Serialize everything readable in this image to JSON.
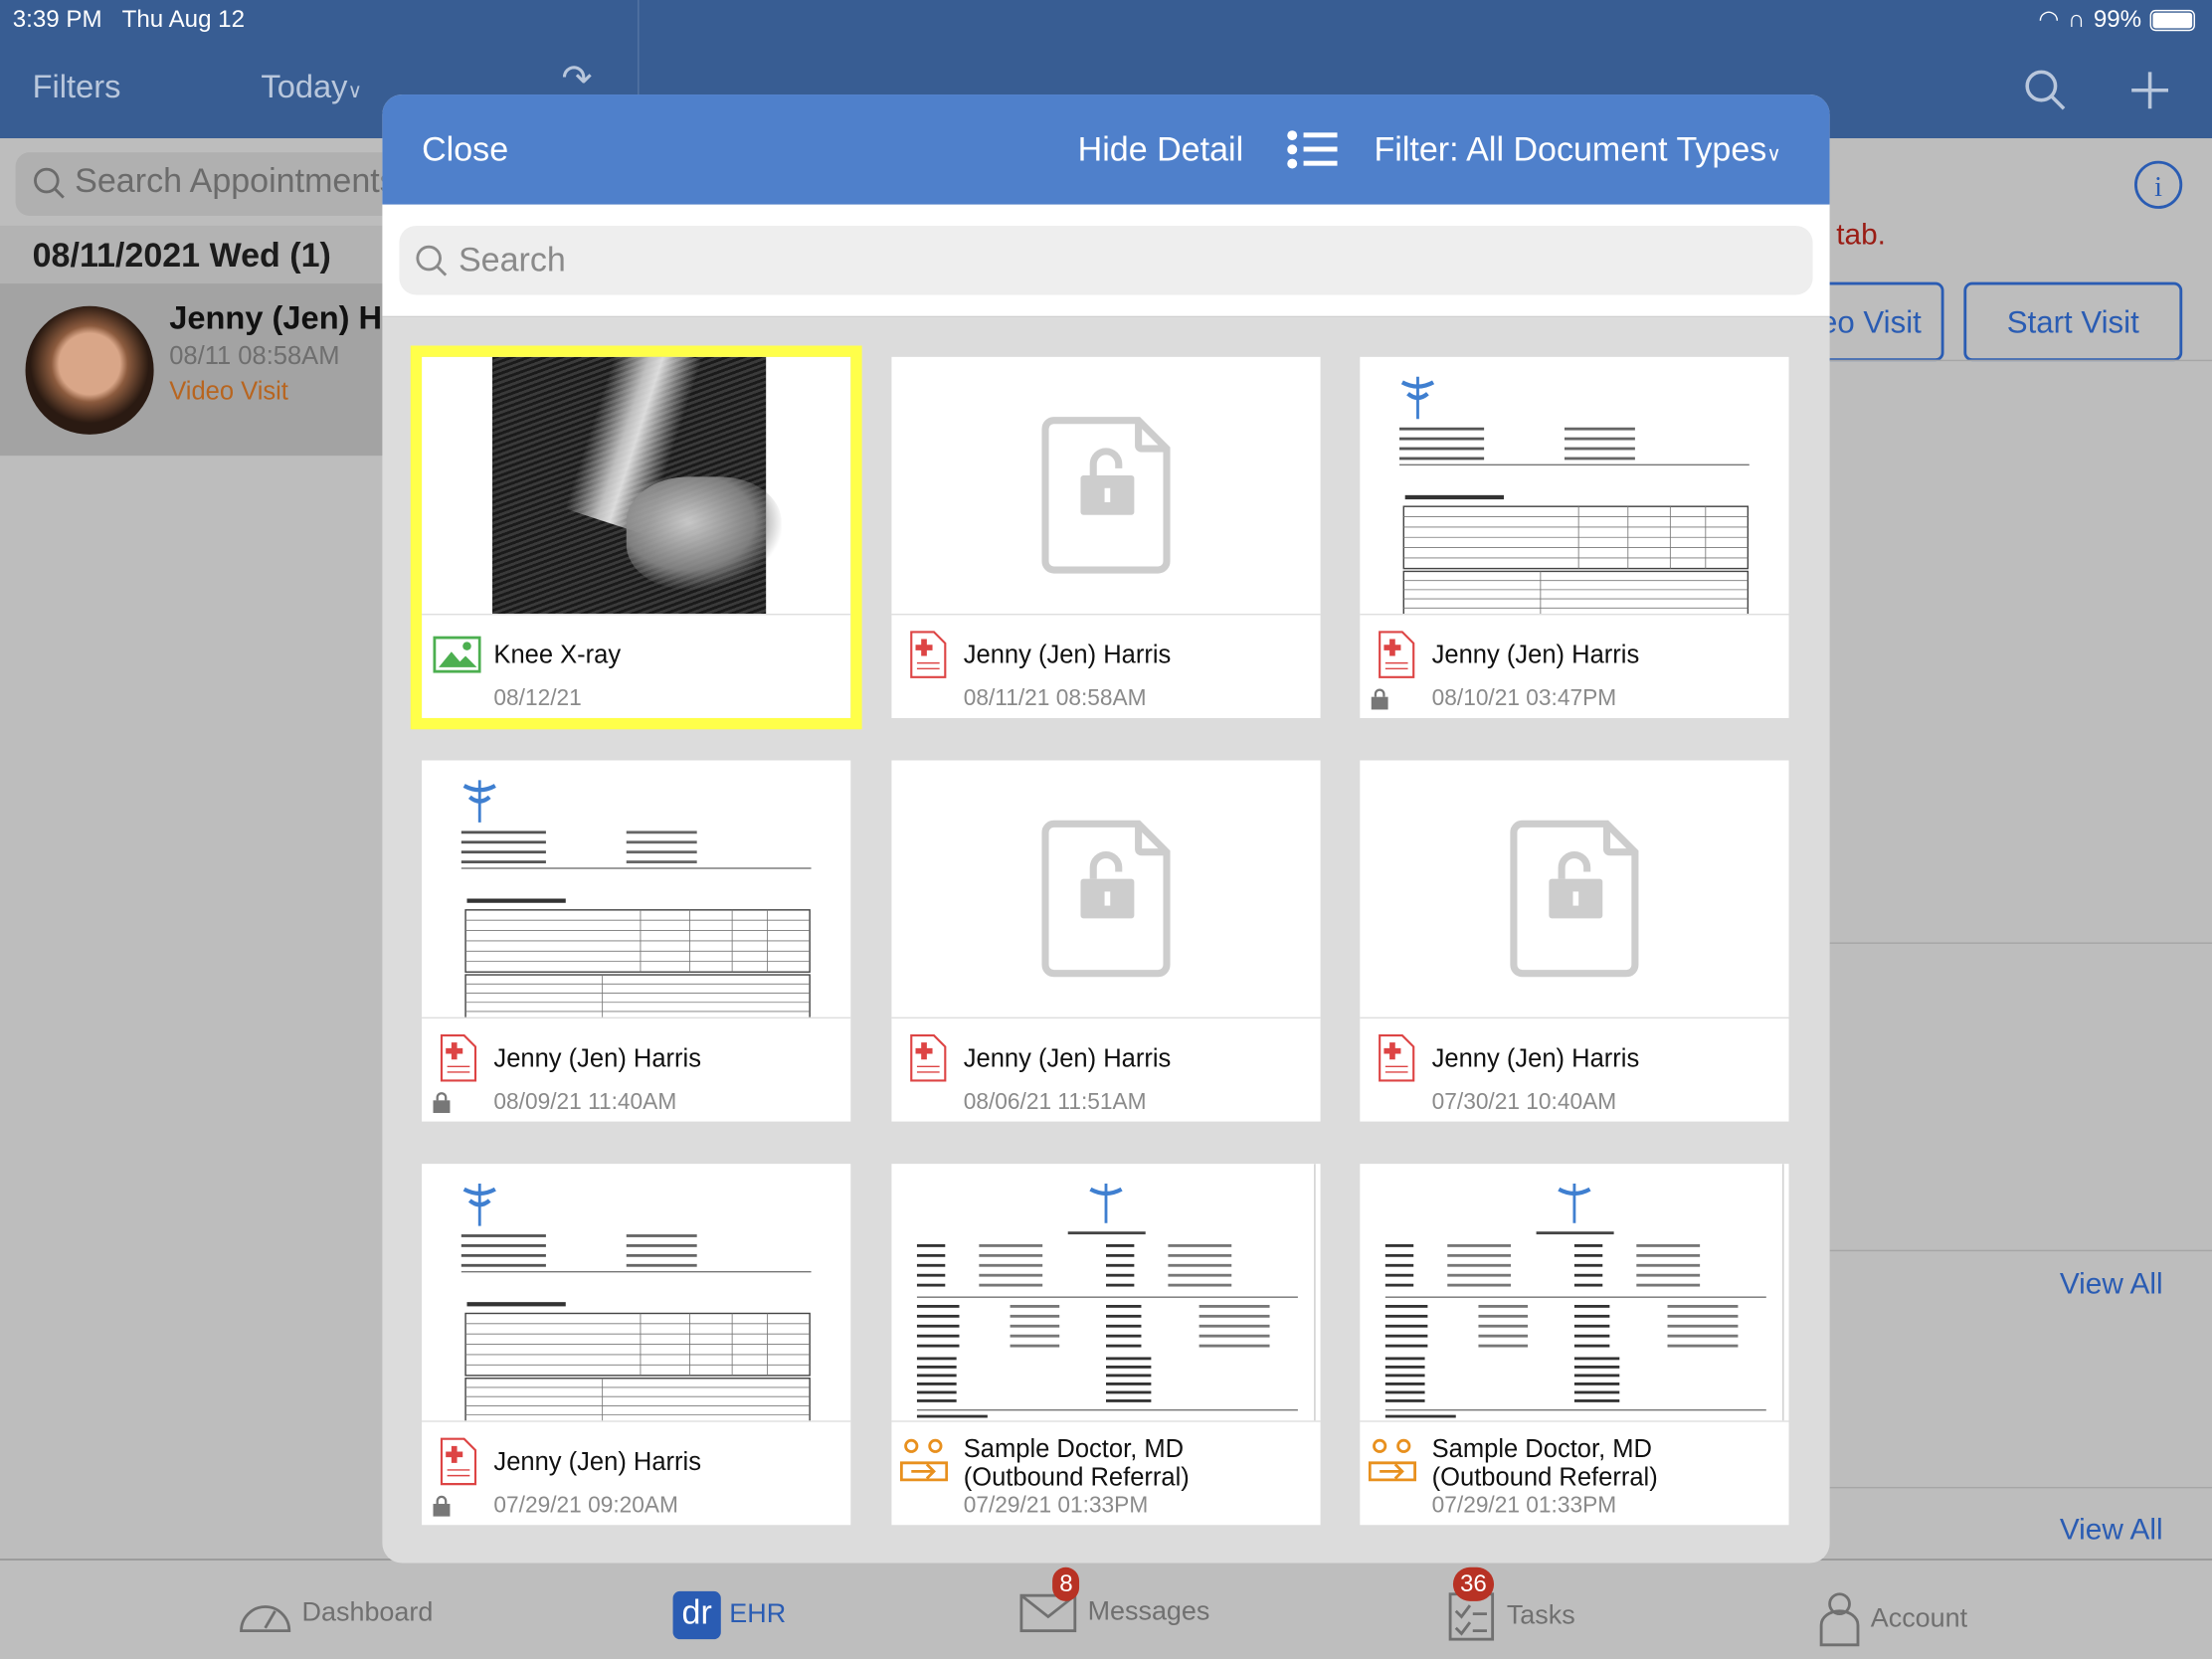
{
  "status_bar": {
    "time": "3:39 PM",
    "date": "Thu Aug 12",
    "battery": "99%"
  },
  "nav": {
    "filters": "Filters",
    "today": "Today"
  },
  "left": {
    "search_placeholder": "Search Appointments",
    "date_header": "08/11/2021 Wed (1)",
    "patient": {
      "name": "Jenny (Jen) Harris",
      "time": "08/11 08:58AM",
      "visit_type": "Video Visit"
    }
  },
  "right": {
    "notice": "t tab.",
    "video_visit_button": "eo Visit",
    "start_visit_button": "Start Visit",
    "view_all_1": "View All",
    "view_all_2": "View All"
  },
  "modal": {
    "close": "Close",
    "hide_detail": "Hide Detail",
    "filter": "Filter: All Document Types",
    "search_placeholder": "Search",
    "cards": [
      {
        "title": "Knee X-ray",
        "date": "08/12/21",
        "thumb": "xray",
        "icon": "image-icon",
        "locked": false,
        "selected": true
      },
      {
        "title": "Jenny (Jen) Harris",
        "date": "08/11/21 08:58AM",
        "thumb": "locked",
        "icon": "document-icon",
        "locked": false
      },
      {
        "title": "Jenny (Jen) Harris",
        "date": "08/10/21 03:47PM",
        "thumb": "doc",
        "icon": "document-icon",
        "locked": true
      },
      {
        "title": "Jenny (Jen) Harris",
        "date": "08/09/21 11:40AM",
        "thumb": "doc",
        "icon": "document-icon",
        "locked": true
      },
      {
        "title": "Jenny (Jen) Harris",
        "date": "08/06/21 11:51AM",
        "thumb": "locked",
        "icon": "document-icon",
        "locked": false
      },
      {
        "title": "Jenny (Jen) Harris",
        "date": "07/30/21 10:40AM",
        "thumb": "locked",
        "icon": "document-icon",
        "locked": false
      },
      {
        "title": "Jenny (Jen) Harris",
        "date": "07/29/21 09:20AM",
        "thumb": "doc",
        "icon": "document-icon",
        "locked": true
      },
      {
        "title": "Sample Doctor, MD",
        "subtitle": "(Outbound Referral)",
        "date": "07/29/21 01:33PM",
        "thumb": "referral",
        "icon": "referral-icon",
        "locked": false
      },
      {
        "title": "Sample Doctor, MD",
        "subtitle": "(Outbound Referral)",
        "date": "07/29/21 01:33PM",
        "thumb": "referral",
        "icon": "referral-icon",
        "locked": false
      }
    ]
  },
  "tabbar": {
    "items": [
      {
        "label": "Dashboard"
      },
      {
        "label": "EHR",
        "active": true
      },
      {
        "label": "Messages",
        "badge": "8"
      },
      {
        "label": "Tasks",
        "badge": "36"
      },
      {
        "label": "Account"
      }
    ]
  },
  "colors": {
    "header": "#4f80cb",
    "accent": "#2a5cb3",
    "badge": "#b83224",
    "selection": "#ffff4a"
  }
}
